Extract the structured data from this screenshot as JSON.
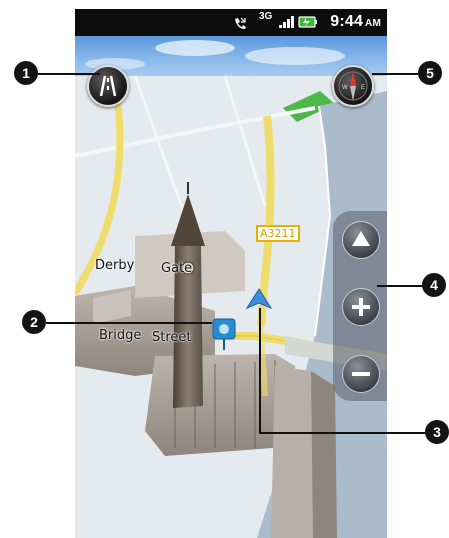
{
  "status_bar": {
    "network": "3G",
    "time": "9:44",
    "ampm": "AM"
  },
  "map": {
    "road_labels": [
      "Derby",
      "Gate",
      "Bridge",
      "Street"
    ],
    "road_sign": "A3211"
  },
  "controls": {
    "lane_view_icon": "lane-guidance-icon",
    "compass_icon": "compass-icon",
    "zoom": [
      "tilt-up-icon",
      "zoom-in-icon",
      "zoom-out-icon"
    ]
  },
  "callouts": [
    "1",
    "2",
    "3",
    "4",
    "5"
  ],
  "colors": {
    "road": "#f3e27a",
    "water": "#a9b8c8",
    "sky": "#6fa6e4",
    "callout": "#141414"
  }
}
